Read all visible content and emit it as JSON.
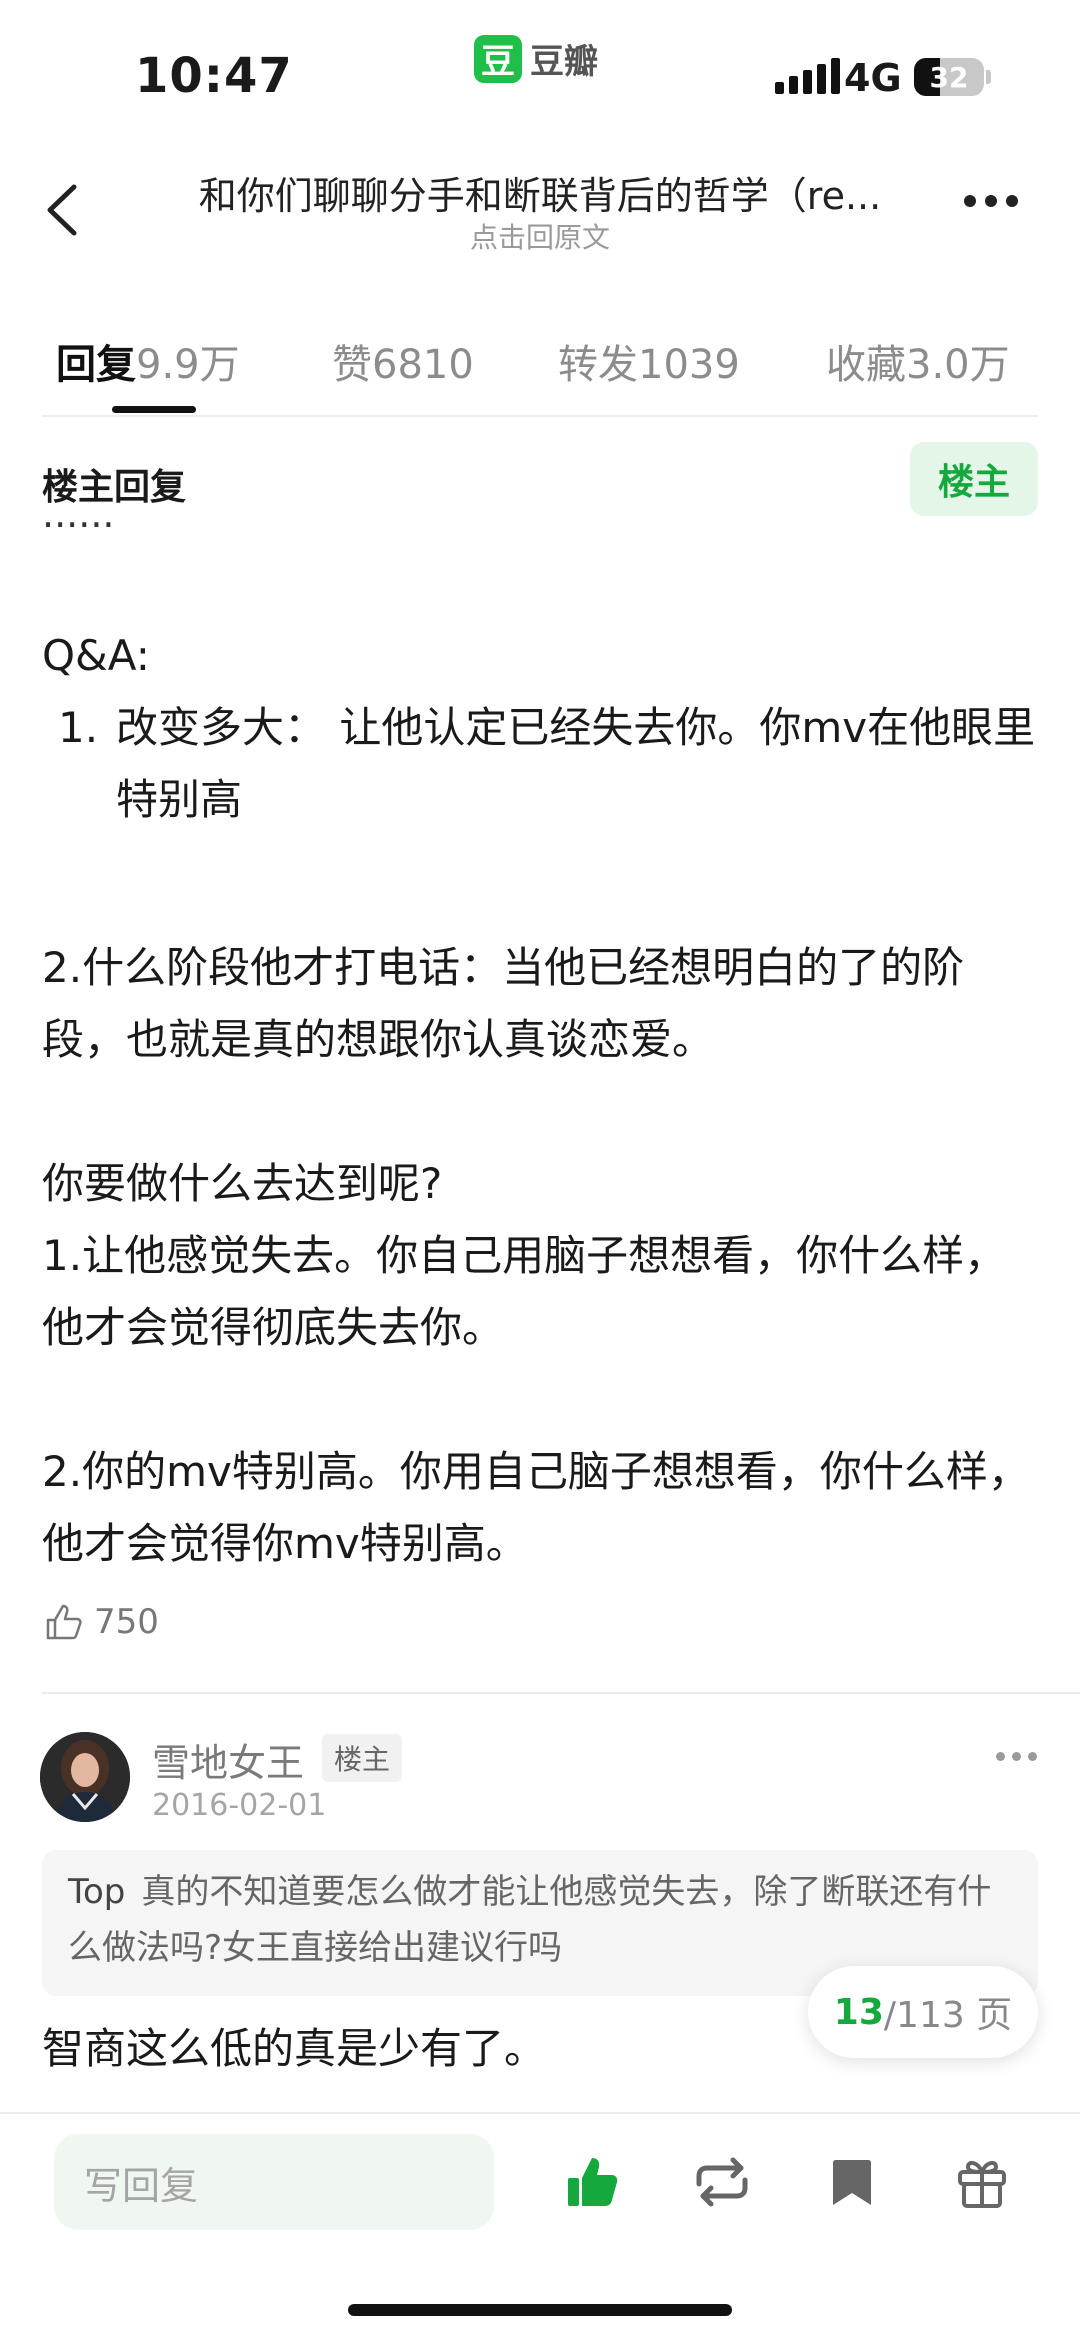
{
  "status_bar": {
    "time": "10:47",
    "app_logo_char": "豆",
    "app_name": "豆瓣",
    "network": "4G",
    "battery": "32"
  },
  "nav": {
    "title": "和你们聊聊分手和断联背后的哲学（re...",
    "subtitle": "点击回原文"
  },
  "tabs": [
    {
      "name": "回复",
      "count": "9.9万"
    },
    {
      "name": "赞",
      "count": "6810"
    },
    {
      "name": "转发",
      "count": "1039"
    },
    {
      "name": "收藏",
      "count": "3.0万"
    }
  ],
  "owner_reply": {
    "header": "楼主回复",
    "tag": "楼主",
    "clipped_text": "......",
    "qa_label": "Q&A:",
    "ol_num": "1.",
    "item1": "改变多大： 让他认定已经失去你。你mv在他眼里特别高",
    "item2": "2.什么阶段他才打电话：当他已经想明白的了的阶段，也就是真的想跟你认真谈恋爱。",
    "question": "你要做什么去达到呢?",
    "answer1": "1.让他感觉失去。你自己用脑子想想看，你什么样，他才会觉得彻底失去你。",
    "answer2": "2.你的mv特别高。你用自己脑子想想看，你什么样，他才会觉得你mv特别高。",
    "likes": "750"
  },
  "comment": {
    "author": "雪地女王",
    "author_tag": "楼主",
    "date": "2016-02-01",
    "quote_lead": "Top",
    "quote_text": "真的不知道要怎么做才能让他感觉失去，除了断联还有什么做法吗?女王直接给出建议行吗",
    "body": "智商这么低的真是少有了。"
  },
  "pager": {
    "current": "13",
    "total": "/113 页"
  },
  "bottom_bar": {
    "reply_placeholder": "写回复"
  },
  "colors": {
    "accent_green": "#15a83c",
    "owner_tag_bg": "#e3f6e8"
  }
}
